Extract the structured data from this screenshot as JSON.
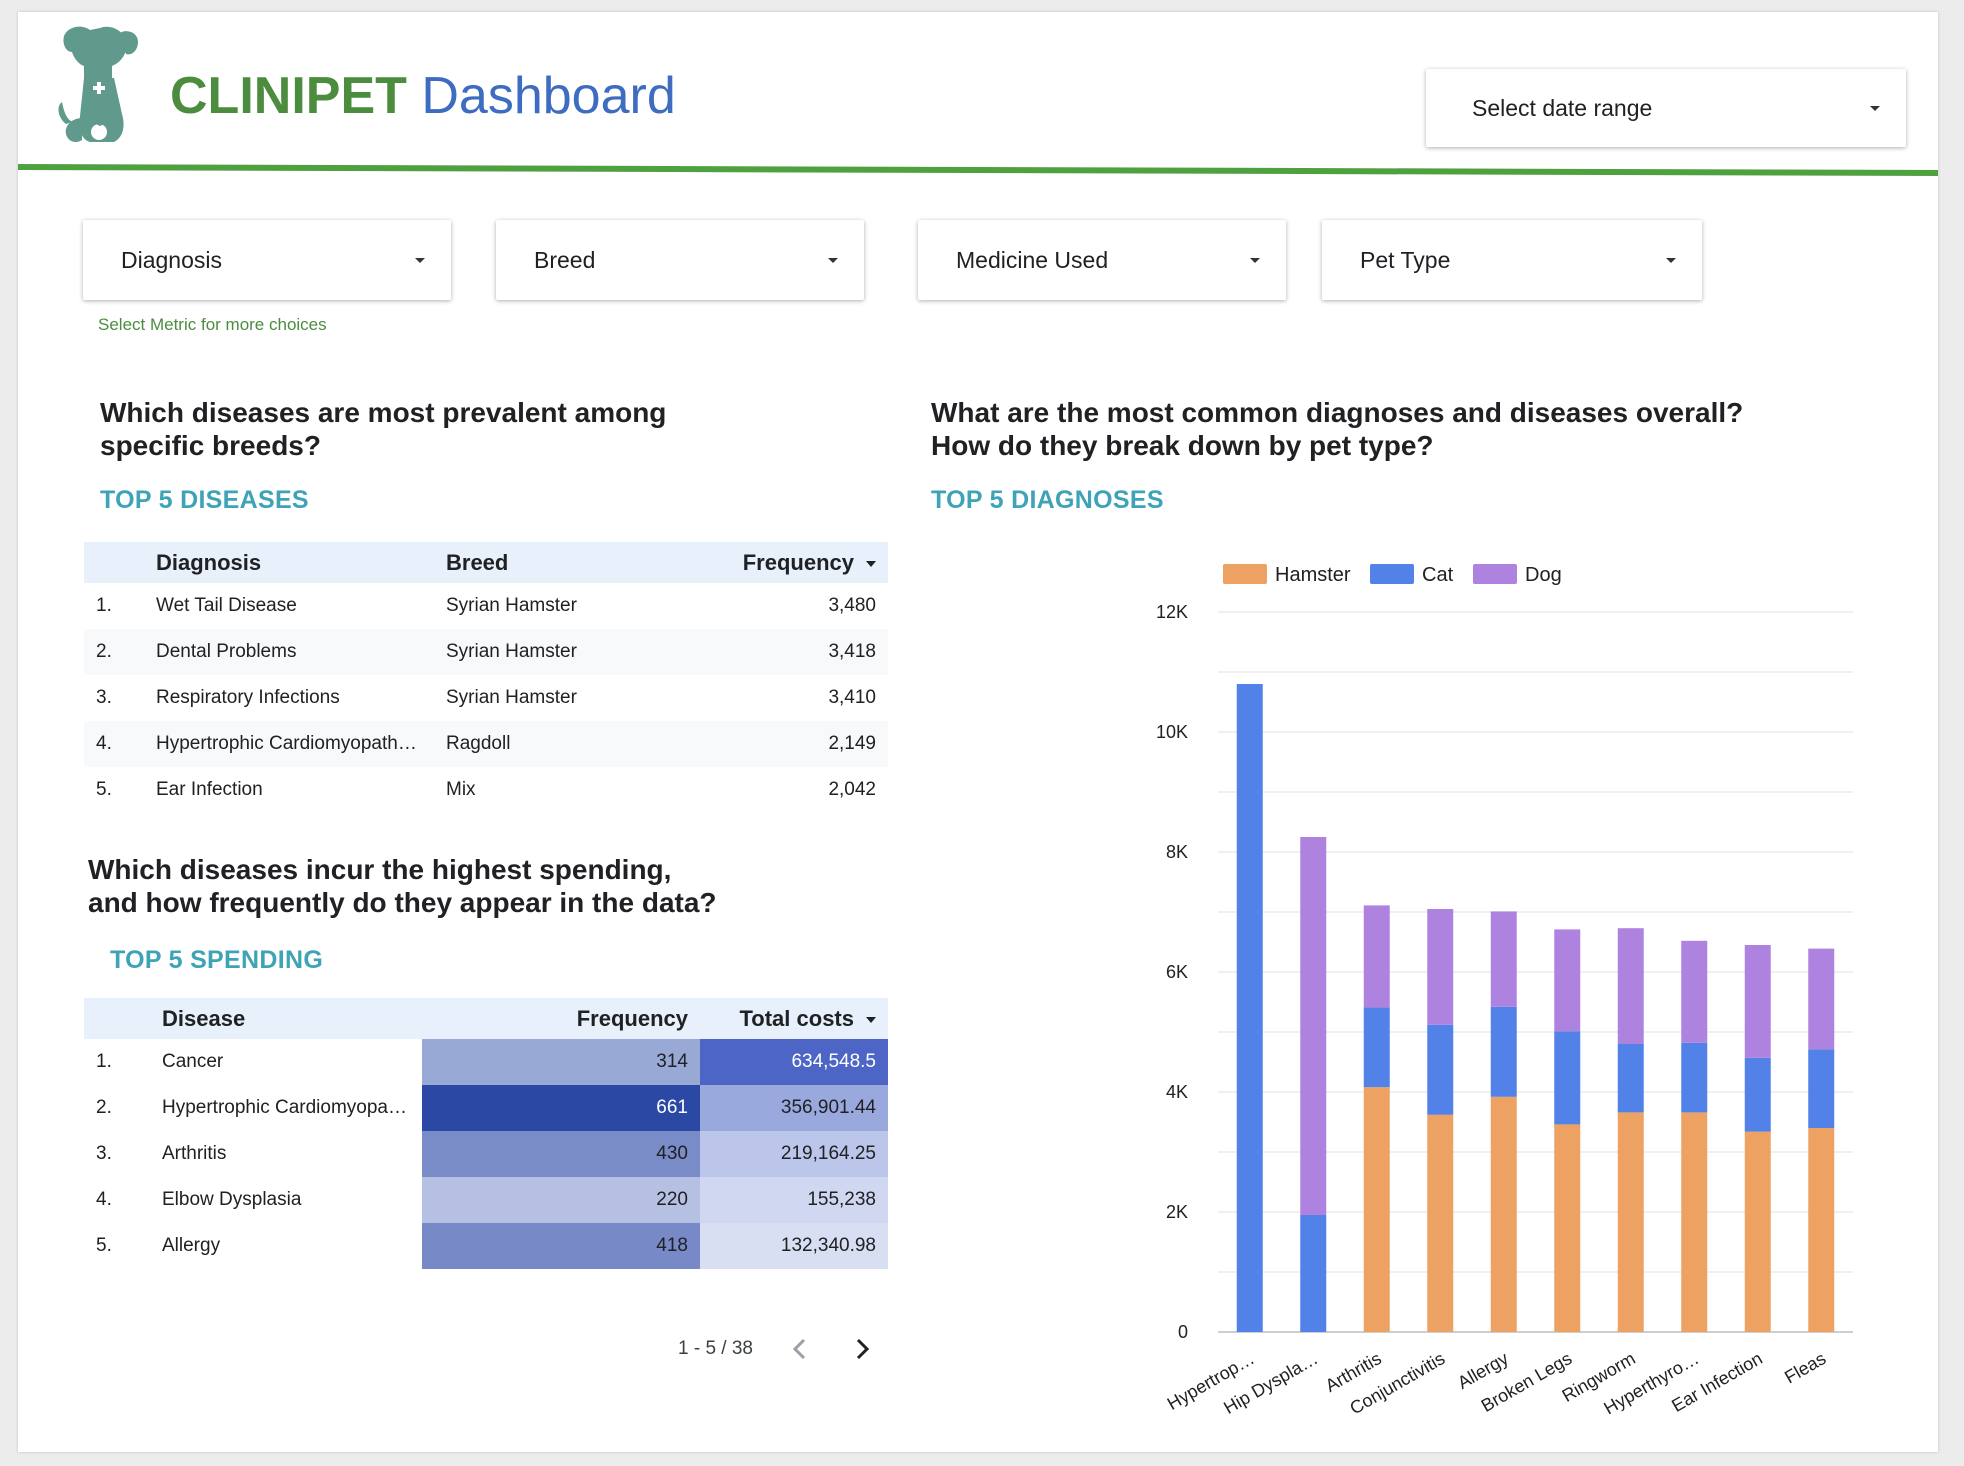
{
  "header": {
    "brand": "CLINIPET",
    "title_rest": "Dashboard",
    "date_range_label": "Select date range"
  },
  "filters": [
    {
      "label": "Diagnosis"
    },
    {
      "label": "Breed"
    },
    {
      "label": "Medicine Used"
    },
    {
      "label": "Pet Type"
    }
  ],
  "hint": "Select Metric for more choices",
  "section1": {
    "question_line1": "Which diseases are most prevalent among",
    "question_line2": "specific breeds?",
    "subhead": "TOP 5 DISEASES",
    "columns": {
      "diagnosis": "Diagnosis",
      "breed": "Breed",
      "frequency": "Frequency"
    },
    "rows": [
      {
        "idx": "1.",
        "diagnosis": "Wet Tail Disease",
        "breed": "Syrian Hamster",
        "frequency": "3,480"
      },
      {
        "idx": "2.",
        "diagnosis": "Dental Problems",
        "breed": "Syrian Hamster",
        "frequency": "3,418"
      },
      {
        "idx": "3.",
        "diagnosis": "Respiratory Infections",
        "breed": "Syrian Hamster",
        "frequency": "3,410"
      },
      {
        "idx": "4.",
        "diagnosis": "Hypertrophic Cardiomyopath…",
        "breed": "Ragdoll",
        "frequency": "2,149"
      },
      {
        "idx": "5.",
        "diagnosis": "Ear Infection",
        "breed": "Mix",
        "frequency": "2,042"
      }
    ]
  },
  "section2": {
    "question_line1": "Which diseases incur the highest spending,",
    "question_line2": "and how frequently do they appear in the data?",
    "subhead": "TOP 5 SPENDING",
    "columns": {
      "disease": "Disease",
      "frequency": "Frequency",
      "total_costs": "Total costs"
    },
    "rows": [
      {
        "idx": "1.",
        "disease": "Cancer",
        "frequency": "314",
        "total_costs": "634,548.5",
        "freq_color": "#99a9d6",
        "cost_color": "#4d66c6"
      },
      {
        "idx": "2.",
        "disease": "Hypertrophic Cardiomyopa…",
        "frequency": "661",
        "total_costs": "356,901.44",
        "freq_color": "#2b48a5",
        "cost_color": "#99a9de"
      },
      {
        "idx": "3.",
        "disease": "Arthritis",
        "frequency": "430",
        "total_costs": "219,164.25",
        "freq_color": "#7a8cc8",
        "cost_color": "#bcc6ea"
      },
      {
        "idx": "4.",
        "disease": "Elbow Dysplasia",
        "frequency": "220",
        "total_costs": "155,238",
        "freq_color": "#b5c0e2",
        "cost_color": "#d0d7f0"
      },
      {
        "idx": "5.",
        "disease": "Allergy",
        "frequency": "418",
        "total_costs": "132,340.98",
        "freq_color": "#7889c8",
        "cost_color": "#d9dff3"
      }
    ],
    "pager": "1 - 5 / 38"
  },
  "section3": {
    "question_line1": "What are the most common diagnoses and diseases overall?",
    "question_line2": "How do they break down by pet type?",
    "subhead": "TOP 5 DIAGNOSES"
  },
  "colors": {
    "brand_green": "#4c8c3f",
    "title_blue": "#3d6cc0",
    "accent_teal": "#3fa3b8"
  },
  "chart_data": {
    "type": "bar",
    "stacked": true,
    "categories": [
      "Hypertrop…",
      "Hip Dyspla…",
      "Arthritis",
      "Conjunctivitis",
      "Allergy",
      "Broken Legs",
      "Ringworm",
      "Hyperthyro…",
      "Ear Infection",
      "Fleas"
    ],
    "series": [
      {
        "name": "Hamster",
        "color": "#eda263",
        "values": [
          0,
          0,
          4080,
          3620,
          3920,
          3460,
          3660,
          3660,
          3340,
          3400
        ]
      },
      {
        "name": "Cat",
        "color": "#5281e8",
        "values": [
          10800,
          1950,
          1330,
          1500,
          1500,
          1550,
          1140,
          1160,
          1230,
          1310
        ]
      },
      {
        "name": "Dog",
        "color": "#ae83e0",
        "values": [
          0,
          6300,
          1700,
          1930,
          1590,
          1700,
          1930,
          1700,
          1880,
          1680
        ]
      }
    ],
    "ylim": [
      0,
      12000
    ],
    "yticks": [
      "0",
      "2K",
      "4K",
      "6K",
      "8K",
      "10K",
      "12K"
    ],
    "grid": true,
    "legend": "top"
  }
}
